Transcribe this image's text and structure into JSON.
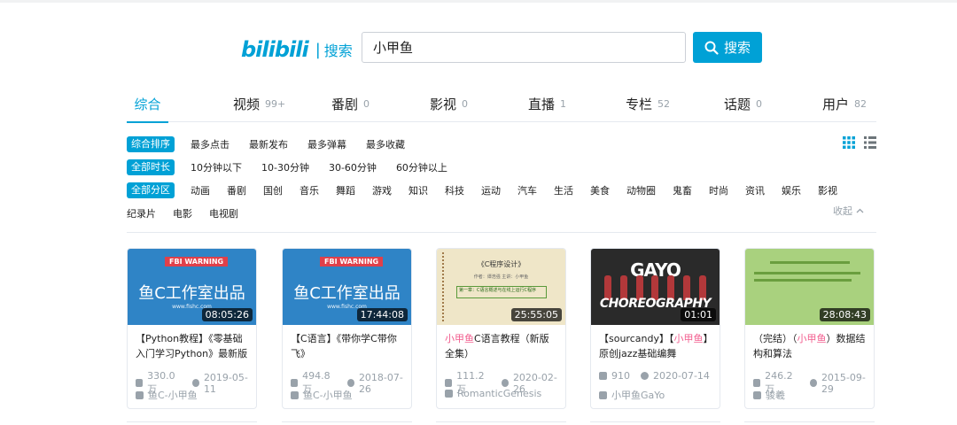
{
  "header": {
    "logo_text": "bilibili",
    "logo_sub": "搜索",
    "search_value": "小甲鱼",
    "search_button": "搜索",
    "colors": {
      "accent": "#00a1d6",
      "highlight": "#f25d8e"
    }
  },
  "tabs": [
    {
      "label": "综合",
      "count": ""
    },
    {
      "label": "视频",
      "count": "99+"
    },
    {
      "label": "番剧",
      "count": "0"
    },
    {
      "label": "影视",
      "count": "0"
    },
    {
      "label": "直播",
      "count": "1"
    },
    {
      "label": "专栏",
      "count": "52"
    },
    {
      "label": "话题",
      "count": "0"
    },
    {
      "label": "用户",
      "count": "82"
    }
  ],
  "filters": {
    "order": {
      "active": "综合排序",
      "options": [
        "最多点击",
        "最新发布",
        "最多弹幕",
        "最多收藏"
      ]
    },
    "duration": {
      "active": "全部时长",
      "options": [
        "10分钟以下",
        "10-30分钟",
        "30-60分钟",
        "60分钟以上"
      ]
    },
    "zone": {
      "active": "全部分区",
      "options": [
        "动画",
        "番剧",
        "国创",
        "音乐",
        "舞蹈",
        "游戏",
        "知识",
        "科技",
        "运动",
        "汽车",
        "生活",
        "美食",
        "动物圈",
        "鬼畜",
        "时尚",
        "资讯",
        "娱乐",
        "影视"
      ],
      "options_row2": [
        "纪录片",
        "电影",
        "电视剧"
      ]
    },
    "collapse_label": "收起"
  },
  "cards": [
    {
      "duration": "08:05:26",
      "title_parts": [
        "【Python教程】《零基础入门学习Python》最新版",
        "",
        ""
      ],
      "views": "330.0万",
      "date": "2019-05-11",
      "author": "鱼C-小甲鱼",
      "thumb": {
        "badge": "FBI WARNING",
        "title": "鱼C工作室出品",
        "url": "www.fishc.com"
      }
    },
    {
      "duration": "17:44:08",
      "title_parts": [
        "【C语言】《带你学C带你飞》",
        "",
        ""
      ],
      "views": "494.8万",
      "date": "2018-07-26",
      "author": "鱼C-小甲鱼",
      "thumb": {
        "badge": "FBI WARNING",
        "title": "鱼C工作室出品",
        "url": "www.fishc.com"
      }
    },
    {
      "duration": "25:55:05",
      "title_parts": [
        "",
        "小甲鱼",
        "C语言教程（新版 全集）"
      ],
      "views": "111.2万",
      "date": "2020-02-26",
      "author": "RomanticGenesis",
      "thumb": {
        "title": "《C程序设计》",
        "line": "作者：谭浩强    主讲：小甲鱼",
        "box": "第一章：C语言概述与在线上运行C程序"
      }
    },
    {
      "duration": "01:01",
      "title_parts": [
        "【sourcandy】【",
        "小甲鱼",
        "】原创jazz基础编舞"
      ],
      "views": "910",
      "date": "2020-07-14",
      "author": "小甲鱼GaYo",
      "thumb": {
        "title": "GAYO",
        "subtitle": "CHOREOGRAPHY"
      }
    },
    {
      "duration": "28:08:43",
      "title_parts": [
        "（完结）（",
        "小甲鱼",
        "）数据结构和算法"
      ],
      "views": "246.2万",
      "date": "2015-09-29",
      "author": "骏羲",
      "thumb": {}
    }
  ]
}
